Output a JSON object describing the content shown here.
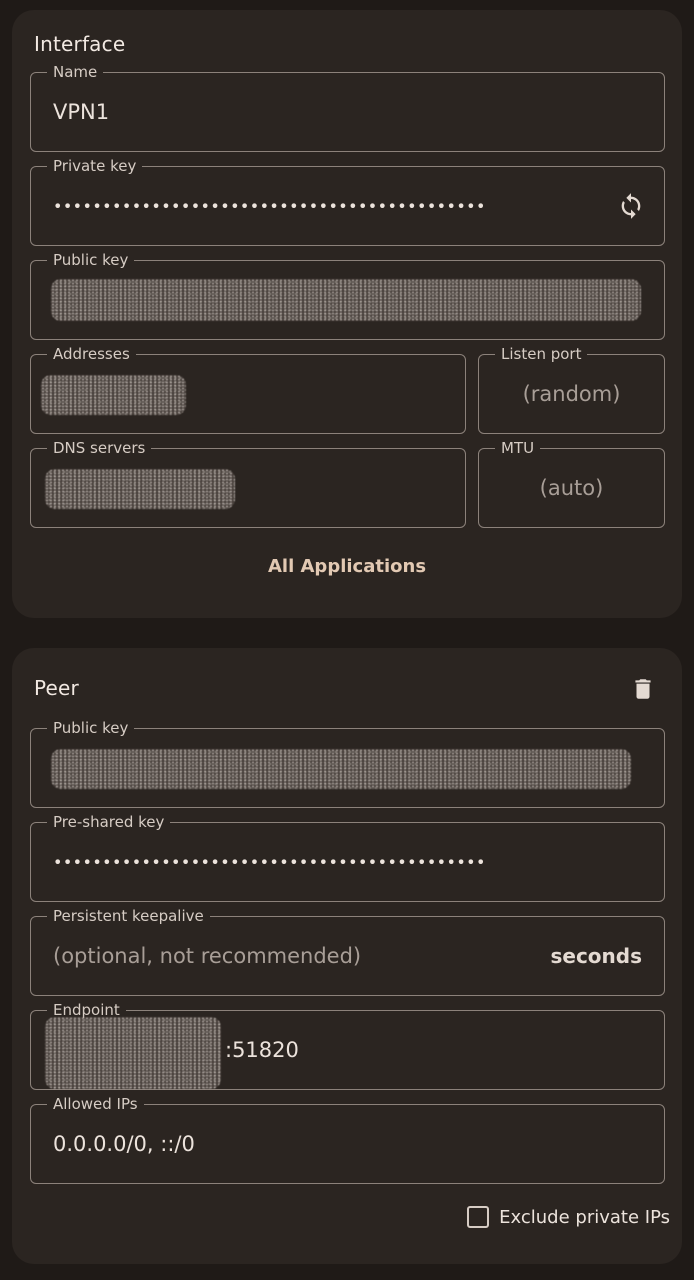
{
  "interface": {
    "title": "Interface",
    "name": {
      "label": "Name",
      "value": "VPN1"
    },
    "private_key": {
      "label": "Private key",
      "value": "••••••••••••••••••••••••••••••••••••••••••••"
    },
    "public_key": {
      "label": "Public key"
    },
    "addresses": {
      "label": "Addresses"
    },
    "listen_port": {
      "label": "Listen port",
      "placeholder": "(random)"
    },
    "dns_servers": {
      "label": "DNS servers"
    },
    "mtu": {
      "label": "MTU",
      "placeholder": "(auto)"
    },
    "applications_button": "All Applications"
  },
  "peer": {
    "title": "Peer",
    "public_key": {
      "label": "Public key"
    },
    "preshared_key": {
      "label": "Pre-shared key",
      "value": "••••••••••••••••••••••••••••••••••••••••••••"
    },
    "persistent_keepalive": {
      "label": "Persistent keepalive",
      "placeholder": "(optional, not recommended)",
      "suffix": "seconds"
    },
    "endpoint": {
      "label": "Endpoint",
      "port_suffix": ":51820"
    },
    "allowed_ips": {
      "label": "Allowed IPs",
      "value": "0.0.0.0/0, ::/0"
    },
    "exclude_private_ips": {
      "label": "Exclude private IPs",
      "checked": false
    }
  },
  "icons": {
    "refresh": "refresh-icon",
    "delete": "trash-icon"
  },
  "colors": {
    "background": "#1f1a17",
    "card": "#2b2521",
    "outline": "#8c827b",
    "accent_text": "#e2c9b3"
  }
}
